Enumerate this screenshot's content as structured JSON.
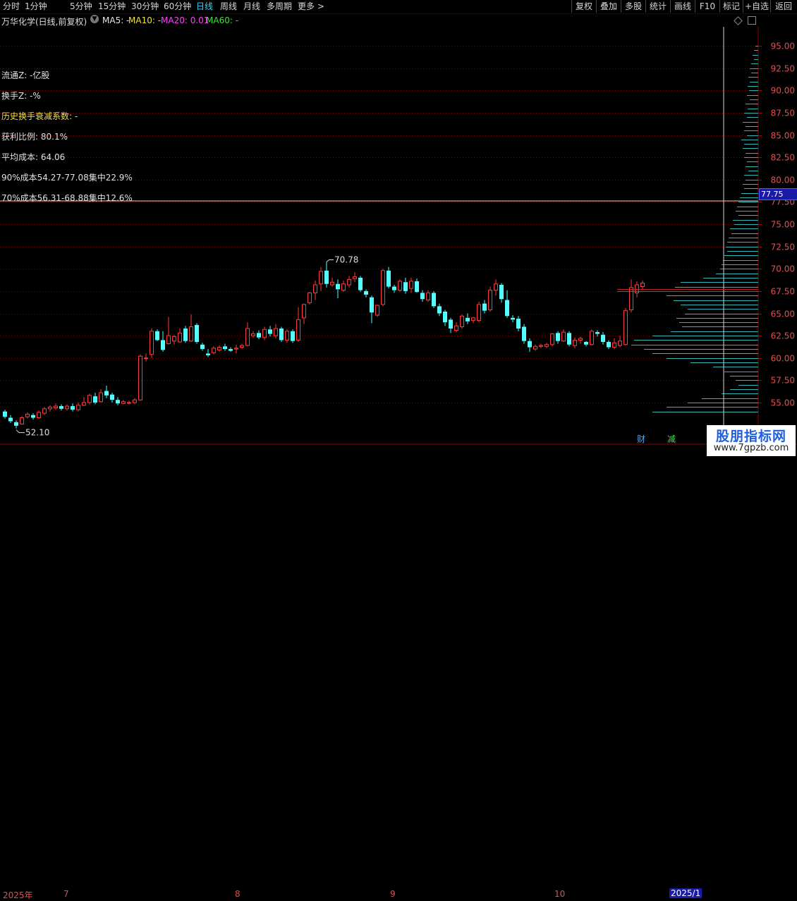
{
  "toolbar": {
    "periods": [
      "分时",
      "1分钟",
      "5分钟",
      "15分钟",
      "30分钟",
      "60分钟",
      "日线",
      "周线",
      "月线",
      "多周期",
      "更多 >"
    ],
    "active_period": "日线",
    "right_buttons": [
      "复权",
      "叠加",
      "多股",
      "统计",
      "画线",
      "F10",
      "标记",
      "+自选",
      "返回"
    ]
  },
  "title": {
    "stock": "万华化学(日线,前复权)",
    "ma5": "MA5: -",
    "ma10": "MA10: -",
    "ma20": "MA20: 0.01",
    "ma60": "MA60: -"
  },
  "stats": {
    "float": "流通Z: -亿股",
    "turnover": "换手Z: -%",
    "decay": "历史换手衰减系数: -",
    "profit": "获利比例: 80.1%",
    "avg_cost": "平均成本: 64.06",
    "cost90": "90%成本54.27-77.08集中22.9%",
    "cost70": "70%成本56.31-68.88集中12.6%"
  },
  "cursor_price": "77.75",
  "bottom": {
    "dates": [
      "2025年",
      "7",
      "8",
      "9",
      "10",
      "2025/1"
    ],
    "fin_label": "财",
    "jian_label": "减"
  },
  "watermark": {
    "line1": "股朋指标网",
    "line2": "www.7gpzb.com"
  },
  "colors": {
    "up": "#ff3c3c",
    "down": "#54ffff",
    "grid": "#7a0000",
    "chip": "#2fb5b5",
    "chip_up": "#d03030"
  },
  "chart_data": {
    "type": "candlestick",
    "y_ticks": [
      "95.00",
      "92.50",
      "90.00",
      "87.50",
      "85.00",
      "82.50",
      "80.00",
      "77.50",
      "75.00",
      "72.50",
      "70.00",
      "67.50",
      "65.00",
      "62.50",
      "60.00",
      "57.50",
      "55.00"
    ],
    "ylim": [
      53.5,
      96.5
    ],
    "annotations": {
      "high": "70.78",
      "low": "52.10"
    },
    "candles": [
      [
        54.0,
        53.4,
        54.2,
        53.2
      ],
      [
        53.3,
        52.9,
        53.6,
        52.7
      ],
      [
        52.8,
        52.4,
        53.0,
        52.1
      ],
      [
        52.6,
        53.3,
        53.5,
        52.5
      ],
      [
        53.4,
        53.7,
        53.9,
        53.2
      ],
      [
        53.6,
        53.3,
        53.8,
        53.1
      ],
      [
        53.3,
        53.9,
        54.1,
        53.2
      ],
      [
        53.8,
        54.3,
        54.5,
        53.6
      ],
      [
        54.3,
        54.5,
        54.7,
        54.0
      ],
      [
        54.4,
        54.6,
        54.9,
        54.2
      ],
      [
        54.6,
        54.3,
        54.8,
        54.1
      ],
      [
        54.3,
        54.6,
        54.8,
        54.1
      ],
      [
        54.6,
        54.2,
        54.9,
        54.0
      ],
      [
        54.2,
        54.7,
        55.0,
        54.0
      ],
      [
        54.7,
        55.0,
        55.6,
        54.6
      ],
      [
        55.0,
        55.8,
        56.0,
        54.8
      ],
      [
        55.7,
        55.0,
        56.1,
        54.8
      ],
      [
        55.1,
        56.1,
        56.5,
        55.0
      ],
      [
        56.3,
        55.8,
        56.9,
        55.5
      ],
      [
        55.9,
        55.3,
        56.1,
        55.0
      ],
      [
        55.3,
        54.9,
        55.6,
        54.7
      ],
      [
        54.9,
        55.1,
        55.3,
        54.8
      ],
      [
        55.0,
        55.0,
        55.2,
        54.8
      ],
      [
        55.0,
        55.3,
        55.5,
        54.8
      ],
      [
        55.3,
        60.2,
        60.4,
        55.2
      ],
      [
        60.0,
        60.0,
        60.5,
        59.6
      ],
      [
        60.4,
        63.0,
        63.3,
        60.0
      ],
      [
        63.0,
        62.0,
        63.2,
        61.9
      ],
      [
        62.0,
        60.9,
        63.0,
        60.7
      ],
      [
        61.6,
        62.5,
        64.6,
        61.5
      ],
      [
        61.9,
        62.4,
        62.6,
        61.5
      ],
      [
        61.8,
        62.8,
        63.3,
        61.7
      ],
      [
        63.3,
        61.9,
        63.6,
        61.7
      ],
      [
        61.9,
        63.5,
        64.9,
        61.8
      ],
      [
        63.7,
        61.8,
        63.9,
        61.6
      ],
      [
        61.5,
        61.0,
        61.7,
        60.8
      ],
      [
        60.5,
        60.3,
        61.0,
        60.1
      ],
      [
        60.6,
        61.1,
        61.3,
        60.4
      ],
      [
        60.9,
        61.2,
        61.4,
        60.7
      ],
      [
        61.3,
        61.0,
        61.6,
        60.8
      ],
      [
        61.0,
        60.8,
        61.2,
        60.7
      ],
      [
        61.0,
        61.1,
        61.5,
        60.5
      ],
      [
        61.2,
        61.4,
        61.6,
        61.0
      ],
      [
        61.4,
        63.3,
        64.0,
        61.3
      ],
      [
        62.5,
        62.7,
        63.0,
        62.3
      ],
      [
        62.8,
        62.3,
        63.1,
        62.1
      ],
      [
        62.3,
        63.2,
        63.5,
        62.0
      ],
      [
        63.2,
        62.7,
        63.6,
        62.4
      ],
      [
        62.5,
        63.3,
        63.8,
        62.2
      ],
      [
        63.3,
        62.0,
        63.5,
        61.8
      ],
      [
        62.0,
        63.0,
        63.2,
        61.7
      ],
      [
        63.0,
        61.9,
        63.2,
        61.7
      ],
      [
        62.0,
        64.3,
        65.7,
        61.8
      ],
      [
        64.5,
        66.0,
        66.1,
        63.8
      ],
      [
        66.2,
        67.3,
        67.4,
        66.0
      ],
      [
        67.3,
        68.2,
        68.7,
        66.5
      ],
      [
        68.3,
        69.7,
        70.2,
        67.5
      ],
      [
        69.8,
        68.3,
        70.8,
        67.9
      ],
      [
        68.2,
        68.5,
        69.0,
        68.0
      ],
      [
        68.3,
        67.7,
        68.8,
        66.7
      ],
      [
        67.6,
        68.3,
        68.7,
        67.4
      ],
      [
        68.2,
        68.8,
        69.2,
        67.9
      ],
      [
        68.9,
        69.1,
        69.6,
        68.5
      ],
      [
        69.0,
        67.6,
        69.2,
        67.4
      ],
      [
        67.5,
        67.1,
        67.7,
        66.8
      ],
      [
        66.8,
        65.1,
        67.0,
        63.9
      ],
      [
        64.8,
        65.9,
        66.0,
        64.6
      ],
      [
        66.0,
        69.8,
        70.0,
        65.8
      ],
      [
        69.8,
        68.0,
        70.2,
        67.8
      ],
      [
        68.0,
        67.6,
        68.2,
        67.3
      ],
      [
        67.6,
        68.6,
        68.8,
        67.4
      ],
      [
        68.5,
        67.5,
        69.0,
        67.2
      ],
      [
        67.8,
        68.6,
        69.0,
        67.3
      ],
      [
        68.6,
        67.4,
        68.9,
        67.3
      ],
      [
        67.3,
        66.6,
        67.6,
        66.3
      ],
      [
        66.5,
        67.3,
        67.6,
        66.3
      ],
      [
        67.3,
        65.8,
        67.5,
        65.6
      ],
      [
        65.8,
        65.0,
        66.1,
        64.7
      ],
      [
        65.2,
        64.0,
        65.4,
        63.6
      ],
      [
        64.3,
        63.3,
        64.5,
        62.8
      ],
      [
        63.1,
        63.6,
        64.0,
        62.9
      ],
      [
        63.5,
        64.7,
        64.9,
        63.3
      ],
      [
        64.5,
        64.1,
        65.0,
        63.8
      ],
      [
        64.2,
        64.5,
        64.6,
        63.9
      ],
      [
        64.2,
        66.0,
        66.3,
        64.0
      ],
      [
        66.1,
        65.3,
        66.5,
        65.0
      ],
      [
        65.4,
        67.6,
        68.0,
        65.2
      ],
      [
        67.6,
        68.3,
        68.8,
        67.0
      ],
      [
        68.2,
        66.6,
        68.4,
        66.2
      ],
      [
        66.5,
        64.7,
        67.6,
        64.5
      ],
      [
        64.5,
        64.3,
        64.8,
        64.0
      ],
      [
        64.4,
        63.3,
        64.7,
        63.0
      ],
      [
        63.5,
        61.9,
        63.8,
        61.6
      ],
      [
        61.9,
        61.2,
        62.2,
        60.7
      ],
      [
        61.0,
        61.3,
        61.5,
        60.8
      ],
      [
        61.3,
        61.4,
        61.6,
        61.1
      ],
      [
        61.3,
        61.5,
        61.7,
        61.1
      ],
      [
        61.5,
        62.7,
        62.8,
        61.3
      ],
      [
        62.8,
        61.9,
        63.0,
        61.6
      ],
      [
        61.9,
        62.9,
        63.2,
        61.8
      ],
      [
        62.8,
        61.5,
        63.0,
        61.3
      ],
      [
        61.4,
        62.0,
        62.3,
        61.1
      ],
      [
        62.0,
        62.2,
        62.4,
        61.6
      ],
      [
        61.8,
        61.5,
        61.9,
        61.3
      ],
      [
        61.5,
        63.0,
        63.2,
        61.4
      ],
      [
        62.9,
        62.7,
        63.1,
        62.4
      ],
      [
        62.6,
        61.8,
        62.9,
        61.5
      ],
      [
        61.8,
        61.2,
        62.0,
        61.0
      ],
      [
        61.2,
        61.7,
        62.2,
        61.0
      ],
      [
        61.4,
        61.9,
        62.5,
        61.2
      ],
      [
        61.5,
        65.3,
        65.6,
        61.4
      ],
      [
        65.4,
        67.9,
        68.8,
        65.1
      ],
      [
        67.3,
        68.2,
        68.6,
        66.8
      ],
      [
        68.0,
        68.4,
        68.7,
        67.7
      ]
    ],
    "chip_bars": [
      [
        95.0,
        4
      ],
      [
        94.5,
        6
      ],
      [
        94.0,
        8
      ],
      [
        93.5,
        6
      ],
      [
        93.0,
        10
      ],
      [
        92.5,
        12
      ],
      [
        92.0,
        10
      ],
      [
        91.5,
        14
      ],
      [
        91.0,
        12
      ],
      [
        90.5,
        15
      ],
      [
        90.0,
        13
      ],
      [
        89.5,
        16
      ],
      [
        89.0,
        12
      ],
      [
        88.5,
        18
      ],
      [
        88.0,
        15
      ],
      [
        87.5,
        20
      ],
      [
        87.0,
        16
      ],
      [
        86.5,
        22
      ],
      [
        86.0,
        18
      ],
      [
        85.5,
        20
      ],
      [
        85.0,
        16
      ],
      [
        84.5,
        24
      ],
      [
        84.0,
        20
      ],
      [
        83.5,
        22
      ],
      [
        83.0,
        18
      ],
      [
        82.5,
        20
      ],
      [
        82.0,
        16
      ],
      [
        81.5,
        18
      ],
      [
        81.0,
        14
      ],
      [
        80.5,
        20
      ],
      [
        80.0,
        18
      ],
      [
        79.5,
        22
      ],
      [
        79.0,
        20
      ],
      [
        78.5,
        24
      ],
      [
        78.0,
        26
      ],
      [
        77.5,
        28
      ],
      [
        77.0,
        30
      ],
      [
        76.5,
        32
      ],
      [
        76.0,
        28
      ],
      [
        75.5,
        36
      ],
      [
        75.0,
        34
      ],
      [
        74.5,
        40
      ],
      [
        74.0,
        38
      ],
      [
        73.5,
        42
      ],
      [
        73.0,
        44
      ],
      [
        72.5,
        46
      ],
      [
        72.0,
        44
      ],
      [
        71.5,
        48
      ],
      [
        71.0,
        50
      ],
      [
        70.5,
        52
      ],
      [
        70.0,
        54
      ],
      [
        69.5,
        60
      ],
      [
        69.0,
        78
      ],
      [
        68.5,
        110
      ],
      [
        68.0,
        118
      ],
      [
        67.5,
        200
      ],
      [
        67.0,
        130
      ],
      [
        66.5,
        120
      ],
      [
        66.0,
        110
      ],
      [
        65.5,
        100
      ],
      [
        65.0,
        104
      ],
      [
        64.5,
        116
      ],
      [
        64.0,
        112
      ],
      [
        63.5,
        108
      ],
      [
        63.0,
        124
      ],
      [
        62.5,
        150
      ],
      [
        62.0,
        176
      ],
      [
        61.5,
        180
      ],
      [
        61.0,
        162
      ],
      [
        60.5,
        150
      ],
      [
        60.0,
        130
      ],
      [
        59.5,
        96
      ],
      [
        59.0,
        64
      ],
      [
        58.5,
        48
      ],
      [
        58.0,
        40
      ],
      [
        57.5,
        32
      ],
      [
        57.0,
        28
      ],
      [
        56.5,
        40
      ],
      [
        56.0,
        52
      ],
      [
        55.5,
        80
      ],
      [
        55.0,
        100
      ],
      [
        54.5,
        130
      ],
      [
        54.0,
        150
      ]
    ]
  }
}
